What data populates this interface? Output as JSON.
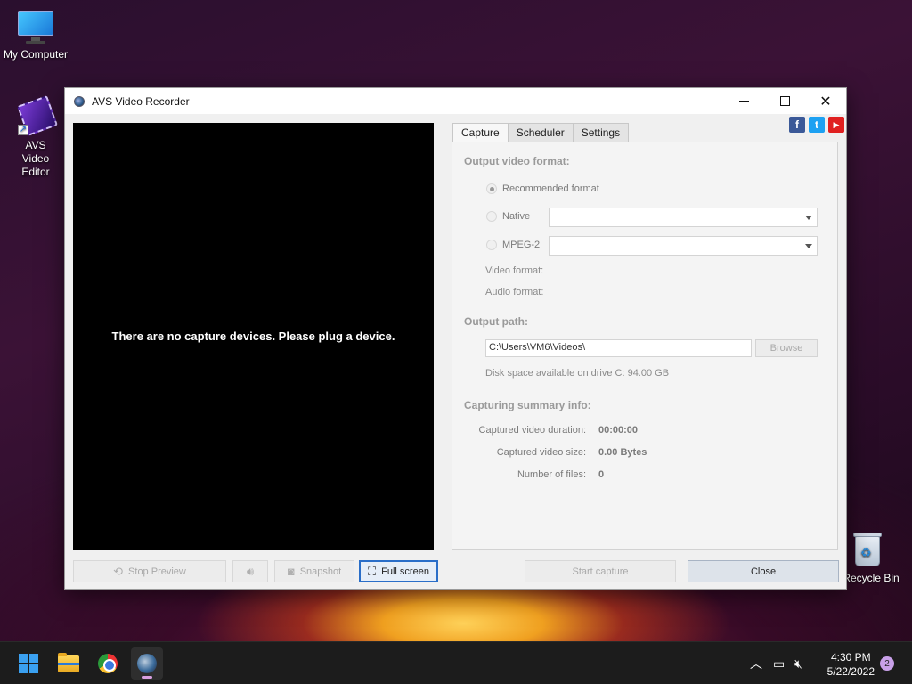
{
  "desktop": {
    "icons": [
      {
        "label": "My Computer"
      },
      {
        "label": "AVS Video Editor"
      },
      {
        "label": "Recycle Bin"
      }
    ]
  },
  "window": {
    "title": "AVS Video Recorder",
    "preview_message": "There are no capture devices. Please plug a device.",
    "social": {
      "facebook": "f",
      "twitter": "t",
      "youtube": "▶"
    },
    "tabs": [
      {
        "label": "Capture",
        "active": true
      },
      {
        "label": "Scheduler",
        "active": false
      },
      {
        "label": "Settings",
        "active": false
      }
    ],
    "capture": {
      "output_format_heading": "Output video format:",
      "recommended_label": "Recommended format",
      "native_label": "Native",
      "native_value": "",
      "mpeg2_label": "MPEG-2",
      "mpeg2_value": "",
      "video_format_label": "Video format:",
      "audio_format_label": "Audio format:",
      "output_path_heading": "Output path:",
      "output_path_value": "C:\\Users\\VM6\\Videos\\",
      "browse_label": "Browse",
      "disk_space": "Disk space available on drive C: 94.00 GB",
      "summary_heading": "Capturing summary info:",
      "summary": [
        {
          "key": "Captured video duration:",
          "value": "00:00:00"
        },
        {
          "key": "Captured video size:",
          "value": "0.00 Bytes"
        },
        {
          "key": "Number of files:",
          "value": "0"
        }
      ]
    },
    "buttons": {
      "stop_preview": "Stop Preview",
      "snapshot": "Snapshot",
      "full_screen": "Full screen",
      "start_capture": "Start capture",
      "close": "Close"
    }
  },
  "taskbar": {
    "clock_time": "4:30 PM",
    "clock_date": "5/22/2022",
    "notification_count": "2"
  }
}
